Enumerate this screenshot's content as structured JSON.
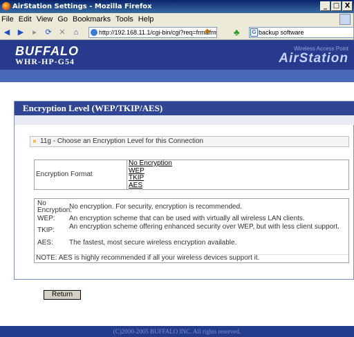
{
  "window": {
    "title": "AirStation Settings - Mozilla Firefox",
    "controls": [
      "_",
      "□",
      "X"
    ]
  },
  "menu": {
    "items": [
      "File",
      "Edit",
      "View",
      "Go",
      "Bookmarks",
      "Tools",
      "Help"
    ]
  },
  "navbar": {
    "url": "http://192.168.11.1/cgi-bin/cgi?req=frm&frm",
    "search_value": "backup software"
  },
  "header": {
    "logo": "BUFFALO",
    "model": "WHR-HP-G54",
    "tagline": "Wireless Access Point",
    "product": "AirStation"
  },
  "panel": {
    "title": "Encryption Level (WEP/TKIP/AES)",
    "section_title": "11g - Choose an Encryption Level for this Connection",
    "format_label": "Encryption Format",
    "format_options": [
      "No Encryption",
      "WEP",
      "TKIP",
      "AES"
    ],
    "descriptions": [
      {
        "label": "No Encryption:",
        "text": "No encryption. For security, encryption is recommended."
      },
      {
        "label": "WEP:",
        "text": "An encryption scheme that can be used with virtually all wireless LAN clients."
      },
      {
        "label": "TKIP:",
        "text": "An encryption scheme offering enhanced security over WEP, but with less client support."
      },
      {
        "label": "AES:",
        "text": "The fastest, most secure wireless encryption available."
      }
    ],
    "note": "NOTE: AES is highly recommended if all your wireless devices support it."
  },
  "actions": {
    "return_label": "Return"
  },
  "footer": {
    "copyright": "(C)2000-2005 BUFFALO INC. All rights reserved."
  }
}
